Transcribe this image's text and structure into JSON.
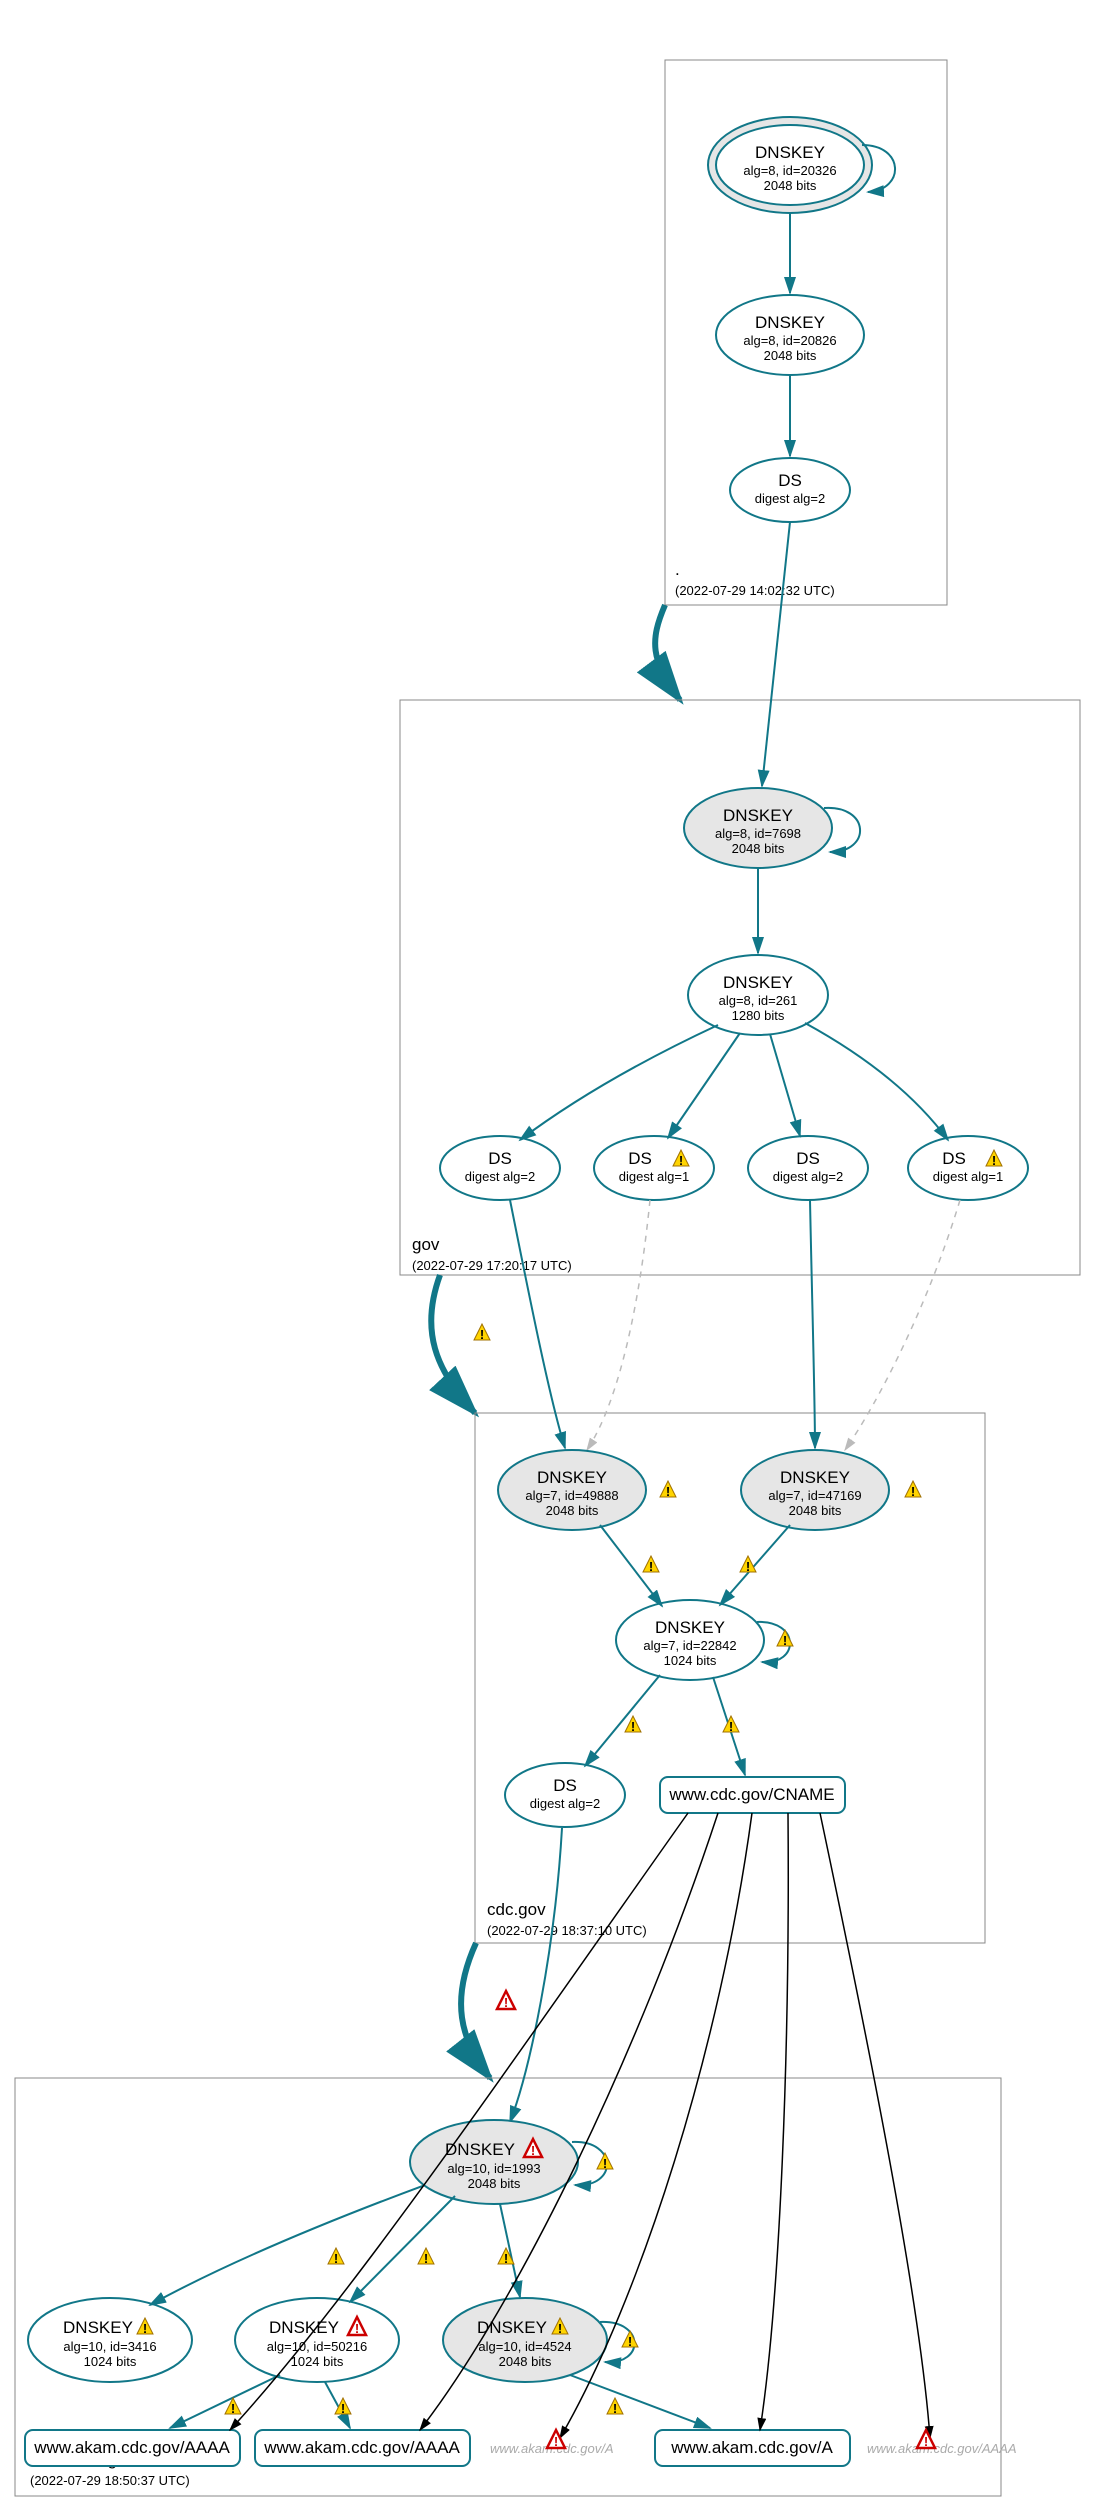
{
  "zones": {
    "root": {
      "label": ".",
      "timestamp": "(2022-07-29 14:02:32 UTC)"
    },
    "gov": {
      "label": "gov",
      "timestamp": "(2022-07-29 17:20:17 UTC)"
    },
    "cdc": {
      "label": "cdc.gov",
      "timestamp": "(2022-07-29 18:37:10 UTC)"
    },
    "akam": {
      "label": "akam.cdc.gov",
      "timestamp": "(2022-07-29 18:50:37 UTC)"
    }
  },
  "nodes": {
    "root_ksk": {
      "title": "DNSKEY",
      "l1": "alg=8, id=20326",
      "l2": "2048 bits"
    },
    "root_zsk": {
      "title": "DNSKEY",
      "l1": "alg=8, id=20826",
      "l2": "2048 bits"
    },
    "root_ds": {
      "title": "DS",
      "l1": "digest alg=2"
    },
    "gov_ksk": {
      "title": "DNSKEY",
      "l1": "alg=8, id=7698",
      "l2": "2048 bits"
    },
    "gov_zsk": {
      "title": "DNSKEY",
      "l1": "alg=8, id=261",
      "l2": "1280 bits"
    },
    "gov_ds1": {
      "title": "DS",
      "l1": "digest alg=2"
    },
    "gov_ds2": {
      "title": "DS",
      "l1": "digest alg=1"
    },
    "gov_ds3": {
      "title": "DS",
      "l1": "digest alg=2"
    },
    "gov_ds4": {
      "title": "DS",
      "l1": "digest alg=1"
    },
    "cdc_k1": {
      "title": "DNSKEY",
      "l1": "alg=7, id=49888",
      "l2": "2048 bits"
    },
    "cdc_k2": {
      "title": "DNSKEY",
      "l1": "alg=7, id=47169",
      "l2": "2048 bits"
    },
    "cdc_zsk": {
      "title": "DNSKEY",
      "l1": "alg=7, id=22842",
      "l2": "1024 bits"
    },
    "cdc_ds": {
      "title": "DS",
      "l1": "digest alg=2"
    },
    "cdc_cname": {
      "title": "www.cdc.gov/CNAME"
    },
    "akam_ksk": {
      "title": "DNSKEY",
      "l1": "alg=10, id=1993",
      "l2": "2048 bits"
    },
    "akam_k1": {
      "title": "DNSKEY",
      "l1": "alg=10, id=3416",
      "l2": "1024 bits"
    },
    "akam_k2": {
      "title": "DNSKEY",
      "l1": "alg=10, id=50216",
      "l2": "1024 bits"
    },
    "akam_k3": {
      "title": "DNSKEY",
      "l1": "alg=10, id=4524",
      "l2": "2048 bits"
    },
    "akam_r1": {
      "title": "www.akam.cdc.gov/AAAA"
    },
    "akam_r2": {
      "title": "www.akam.cdc.gov/AAAA"
    },
    "akam_r3": {
      "title": "www.akam.cdc.gov/A"
    },
    "akam_ghost_a": {
      "title": "www.akam.cdc.gov/A"
    },
    "akam_ghost_aaaa": {
      "title": "www.akam.cdc.gov/AAAA"
    }
  }
}
